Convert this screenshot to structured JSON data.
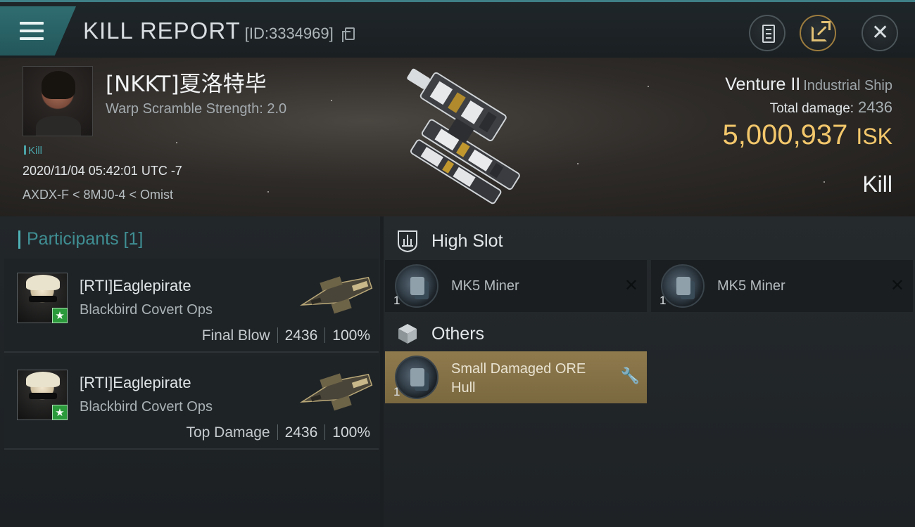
{
  "header": {
    "title": "KILL REPORT",
    "report_id": "[ID:3334969]"
  },
  "victim": {
    "name": "[NKKT]夏洛特毕",
    "warp_scramble": "Warp Scramble Strength: 2.0",
    "tag": "Kill",
    "datetime": "2020/11/04 05:42:01 UTC -7",
    "route": "AXDX-F < 8MJ0-4 < Omist",
    "ship_name": "Venture II",
    "ship_class": "Industrial Ship",
    "total_damage_label": "Total damage:",
    "total_damage": "2436",
    "isk_value": "5,000,937",
    "isk_unit": "ISK",
    "result": "Kill"
  },
  "participants": {
    "title": "Participants [1]",
    "rows": [
      {
        "name": "[RTI]Eaglepirate",
        "ship": "Blackbird Covert Ops",
        "label": "Final Blow",
        "damage": "2436",
        "percent": "100%"
      },
      {
        "name": "[RTI]Eaglepirate",
        "ship": "Blackbird Covert Ops",
        "label": "Top Damage",
        "damage": "2436",
        "percent": "100%"
      }
    ]
  },
  "fitting": {
    "high_slot": {
      "title": "High Slot",
      "modules": [
        {
          "qty": "1",
          "name": "MK5 Miner"
        },
        {
          "qty": "1",
          "name": "MK5 Miner"
        }
      ]
    },
    "others": {
      "title": "Others",
      "modules": [
        {
          "qty": "1",
          "name": "Small Damaged ORE Hull"
        }
      ]
    }
  },
  "colors": {
    "accent_teal": "#3f8e93",
    "isk_gold": "#f3c76b",
    "highlight_gold": "#8f7a4d"
  }
}
